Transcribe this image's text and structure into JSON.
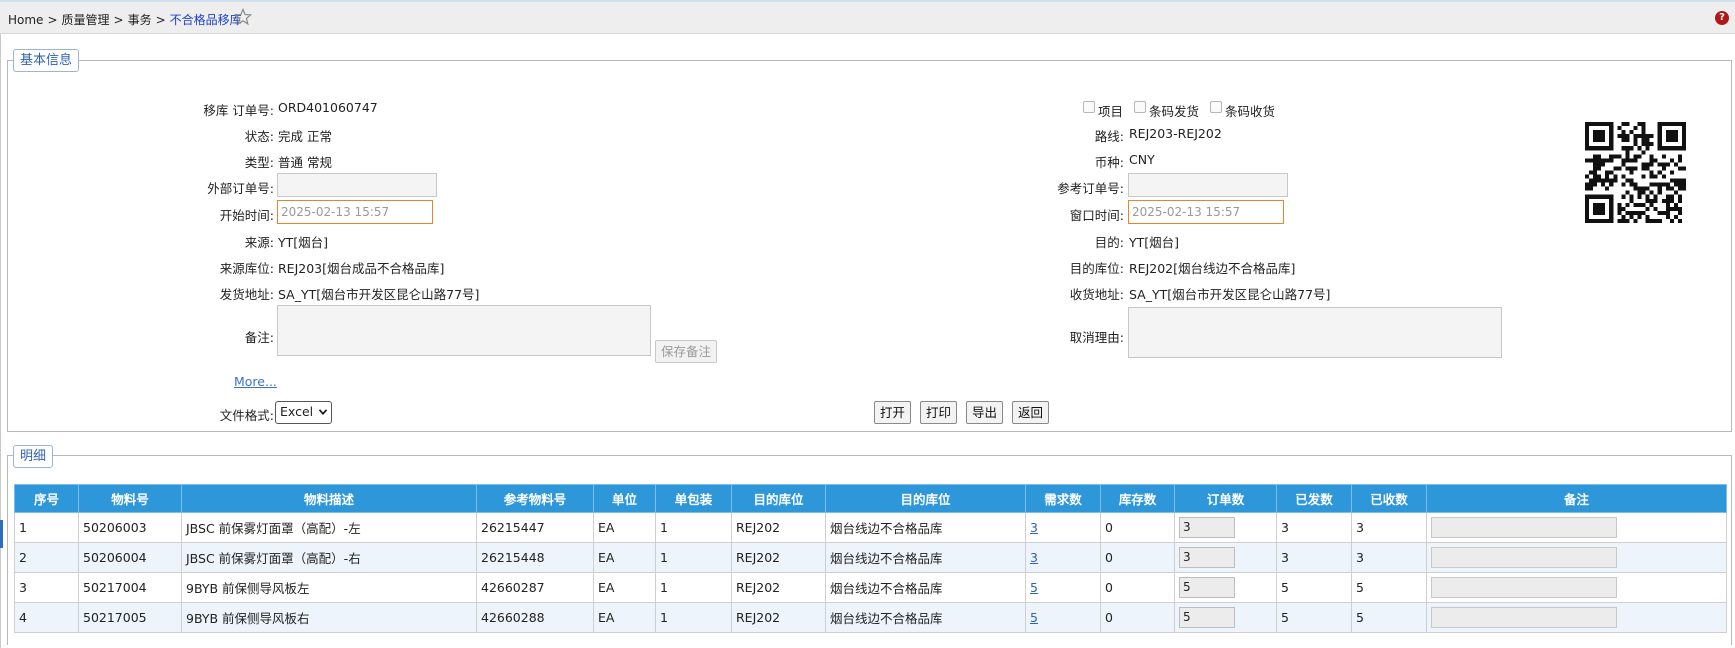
{
  "breadcrumb": {
    "home": "Home",
    "sep": ">",
    "level1": "质量管理",
    "level2": "事务",
    "current": "不合格品移库"
  },
  "basic_section": {
    "legend": "基本信息",
    "left": {
      "order_no_label": "移库 订单号:",
      "order_no": "ORD401060747",
      "status_label": "状态:",
      "status": "完成 正常",
      "type_label": "类型:",
      "type": "普通 常规",
      "external_order_label": "外部订单号:",
      "external_order": "",
      "start_time_label": "开始时间:",
      "start_time": "2025-02-13 15:57",
      "source_label": "来源:",
      "source": "YT[烟台]",
      "source_location_label": "来源库位:",
      "source_location": "REJ203[烟台成品不合格品库]",
      "ship_address_label": "发货地址:",
      "ship_address": "SA_YT[烟台市开发区昆仑山路77号]",
      "note_label": "备注:",
      "save_note_button": "保存备注",
      "more_link": "More...",
      "file_format_label": "文件格式:",
      "file_format": "Excel"
    },
    "right": {
      "checkbox_project": "项目",
      "checkbox_barcode_ship": "条码发货",
      "checkbox_barcode_receive": "条码收货",
      "route_label": "路线:",
      "route": "REJ203-REJ202",
      "currency_label": "币种:",
      "currency": "CNY",
      "ref_order_label": "参考订单号:",
      "ref_order": "",
      "window_time_label": "窗口时间:",
      "window_time": "2025-02-13 15:57",
      "destination_label": "目的:",
      "destination": "YT[烟台]",
      "dest_location_label": "目的库位:",
      "dest_location": "REJ202[烟台线边不合格品库]",
      "receive_address_label": "收货地址:",
      "receive_address": "SA_YT[烟台市开发区昆仑山路77号]",
      "cancel_reason_label": "取消理由:"
    },
    "actions": {
      "open": "打开",
      "print": "打印",
      "export": "导出",
      "back": "返回"
    }
  },
  "detail_section": {
    "legend": "明细",
    "columns": [
      "序号",
      "物料号",
      "物料描述",
      "参考物料号",
      "单位",
      "单包装",
      "目的库位",
      "目的库位",
      "需求数",
      "库存数",
      "订单数",
      "已发数",
      "已收数",
      "备注"
    ],
    "rows": [
      {
        "seq": "1",
        "material": "50206003",
        "desc": "JBSC 前保雾灯面罩（高配）-左",
        "ref": "26215447",
        "unit": "EA",
        "pack": "1",
        "dest_code": "REJ202",
        "dest_name": "烟台线边不合格品库",
        "demand": "3",
        "stock": "0",
        "ordered": "3",
        "shipped": "3",
        "received": "3"
      },
      {
        "seq": "2",
        "material": "50206004",
        "desc": "JBSC 前保雾灯面罩（高配）-右",
        "ref": "26215448",
        "unit": "EA",
        "pack": "1",
        "dest_code": "REJ202",
        "dest_name": "烟台线边不合格品库",
        "demand": "3",
        "stock": "0",
        "ordered": "3",
        "shipped": "3",
        "received": "3"
      },
      {
        "seq": "3",
        "material": "50217004",
        "desc": "9BYB 前保侧导风板左",
        "ref": "42660287",
        "unit": "EA",
        "pack": "1",
        "dest_code": "REJ202",
        "dest_name": "烟台线边不合格品库",
        "demand": "5",
        "stock": "0",
        "ordered": "5",
        "shipped": "5",
        "received": "5"
      },
      {
        "seq": "4",
        "material": "50217005",
        "desc": "9BYB 前保侧导风板右",
        "ref": "42660288",
        "unit": "EA",
        "pack": "1",
        "dest_code": "REJ202",
        "dest_name": "烟台线边不合格品库",
        "demand": "5",
        "stock": "0",
        "ordered": "5",
        "shipped": "5",
        "received": "5"
      }
    ]
  },
  "colors": {
    "header_blue": "#2e97da",
    "link_blue": "#2f62b4",
    "date_border": "#e8842c",
    "alt_row": "#eef4fb"
  },
  "icons": {
    "favorite": "star-outline-icon",
    "help": "question-circle-icon",
    "qr": "qr-code-image"
  }
}
